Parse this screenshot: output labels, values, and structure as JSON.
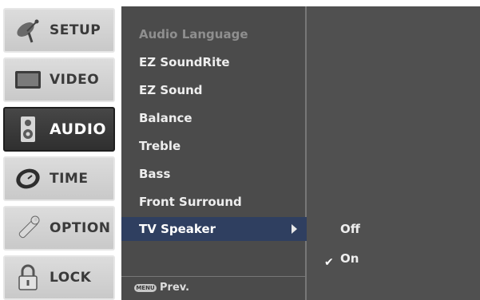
{
  "sidebar": {
    "items": [
      {
        "label": "SETUP",
        "icon": "satellite-icon",
        "active": false
      },
      {
        "label": "VIDEO",
        "icon": "tv-screen-icon",
        "active": false
      },
      {
        "label": "AUDIO",
        "icon": "speaker-icon",
        "active": true
      },
      {
        "label": "TIME",
        "icon": "clock-icon",
        "active": false
      },
      {
        "label": "OPTION",
        "icon": "wrench-icon",
        "active": false
      },
      {
        "label": "LOCK",
        "icon": "padlock-icon",
        "active": false
      }
    ]
  },
  "audio_menu": {
    "items": [
      {
        "label": "Audio Language",
        "enabled": false
      },
      {
        "label": "EZ SoundRite",
        "enabled": true
      },
      {
        "label": "EZ Sound",
        "enabled": true
      },
      {
        "label": "Balance",
        "enabled": true
      },
      {
        "label": "Treble",
        "enabled": true
      },
      {
        "label": "Bass",
        "enabled": true
      },
      {
        "label": "Front Surround",
        "enabled": true
      }
    ],
    "selected": {
      "label": "TV Speaker",
      "arrow": "right-arrow-icon"
    },
    "footer": {
      "key_label": "MENU",
      "label": "Prev."
    }
  },
  "submenu": {
    "options": [
      {
        "label": "Off",
        "checked": false
      },
      {
        "label": "On",
        "checked": true
      }
    ],
    "check_glyph": "✔"
  },
  "colors": {
    "menu_bg": "#4b4b4b",
    "highlight": "#2f3f60",
    "active_tab": "#3a3a3a"
  }
}
